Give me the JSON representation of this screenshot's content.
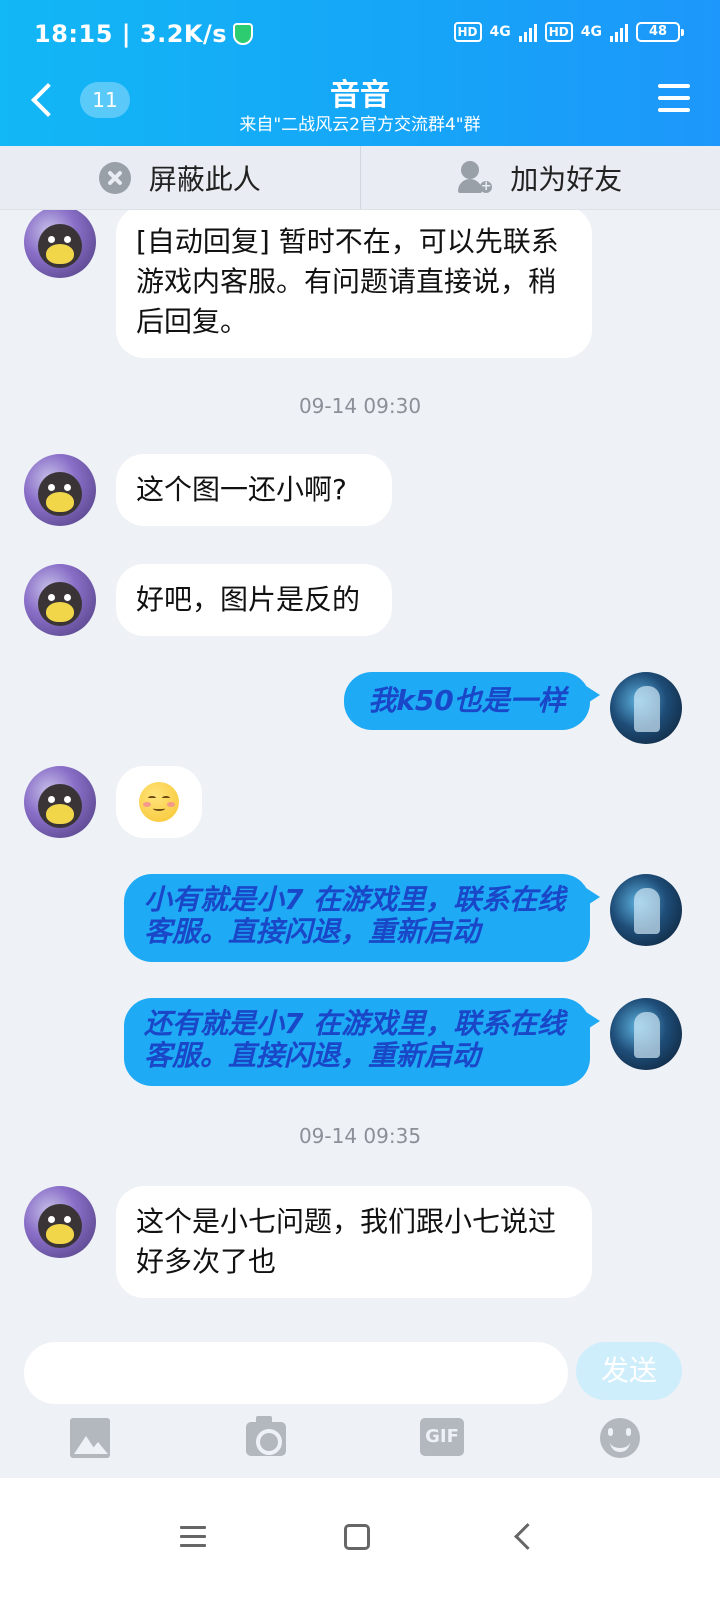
{
  "status_bar": {
    "time_speed": "18:15 | 3.2K/s",
    "hd1": "HD",
    "net1": "4G",
    "hd2": "HD",
    "net2": "4G",
    "battery": "48"
  },
  "header": {
    "unread_badge": "11",
    "title": "音音",
    "subtitle": "来自\"二战风云2官方交流群4\"群"
  },
  "actions": {
    "block_label": "屏蔽此人",
    "add_friend_label": "加为好友"
  },
  "timestamps": [
    "09-14 09:30",
    "09-14 09:35"
  ],
  "messages": [
    {
      "sender": "other",
      "text": "[自动回复] 暂时不在，可以先联系游戏内客服。有问题请直接说，稍后回复。"
    },
    {
      "sender": "other",
      "text": "这个图一还小啊?"
    },
    {
      "sender": "other",
      "text": "好吧，图片是反的"
    },
    {
      "sender": "self",
      "text": "我k50也是一样"
    },
    {
      "sender": "other",
      "emoji": "blush-emoji"
    },
    {
      "sender": "self",
      "text": "小有就是小7    在游戏里，联系在线客服。直接闪退，重新启动"
    },
    {
      "sender": "self",
      "text": "还有就是小7    在游戏里，联系在线客服。直接闪退，重新启动"
    },
    {
      "sender": "other",
      "text": "这个是小七问题，我们跟小七说过好多次了也"
    }
  ],
  "composer": {
    "input_value": "",
    "send_label": "发送",
    "tool_gif_label": "GIF"
  },
  "colors": {
    "header_gradient_start": "#12b7f5",
    "header_gradient_end": "#1d97fb",
    "self_bubble": "#1eaaf5",
    "self_text": "#1a47c8",
    "send_button": "#cfeefc"
  }
}
